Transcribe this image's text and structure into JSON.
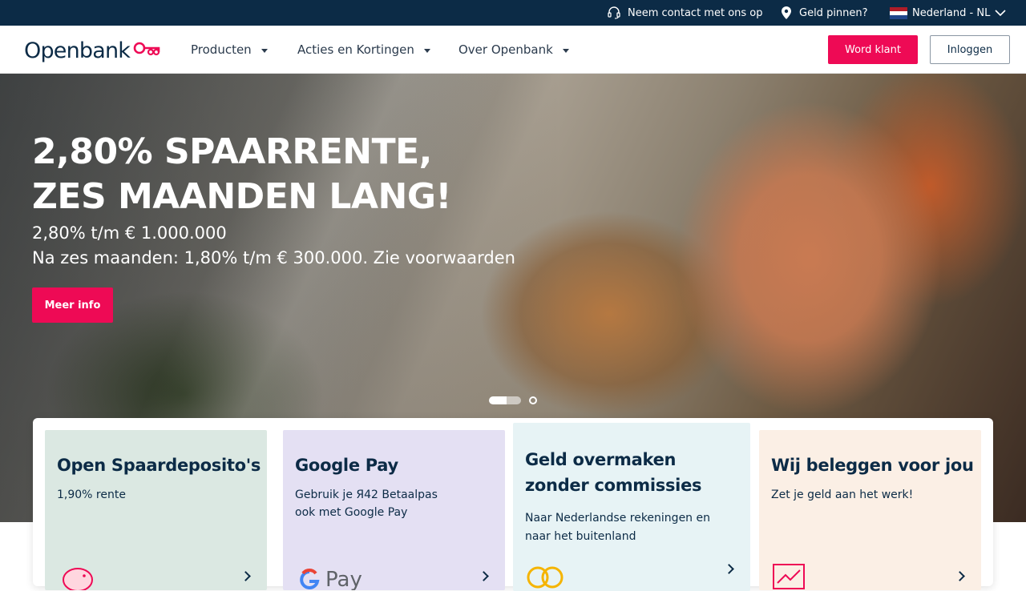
{
  "topbar": {
    "contact_label": "Neem contact met ons op",
    "atm_label": "Geld pinnen?",
    "language_label": "Nederland - NL"
  },
  "nav": {
    "logo_text": "Openbank",
    "menu": [
      {
        "label": "Producten"
      },
      {
        "label": "Acties en Kortingen"
      },
      {
        "label": "Over Openbank"
      }
    ],
    "signup_label": "Word klant",
    "login_label": "Inloggen"
  },
  "hero": {
    "title_line1": "2,80% SPAARRENTE,",
    "title_line2": "ZES MAANDEN LANG!",
    "subtitle_line1": "2,80% t/m € 1.000.000",
    "subtitle_line2": "Na zes maanden: 1,80% t/m € 300.000. Zie voorwaarden",
    "cta_label": "Meer info",
    "active_slide": 1,
    "slide_count": 2
  },
  "cards": [
    {
      "title": "Open Spaardeposito's",
      "text": "1,90% rente",
      "bg": "#dbe8e2",
      "icon": "piggy-bank-icon"
    },
    {
      "title": "Google Pay",
      "text_line1": "Gebruik je Я42 Betaalpas",
      "text_line2": "ook met Google Pay",
      "bg": "#e4e0f3",
      "icon": "google-pay-icon"
    },
    {
      "title_line1": "Geld overmaken",
      "title_line2": "zonder commissies",
      "text_line1": "Naar Nederlandse rekeningen en",
      "text_line2": "naar het buitenland",
      "bg": "#e7f3f5",
      "icon": "euro-coin-icon"
    },
    {
      "title": "Wij beleggen voor jou",
      "text": "Zet je geld aan het werk!",
      "bg": "#fbefe5",
      "icon": "growth-chart-icon"
    }
  ],
  "colors": {
    "brand_navy": "#0c2b46",
    "brand_pink": "#ee0a55"
  }
}
